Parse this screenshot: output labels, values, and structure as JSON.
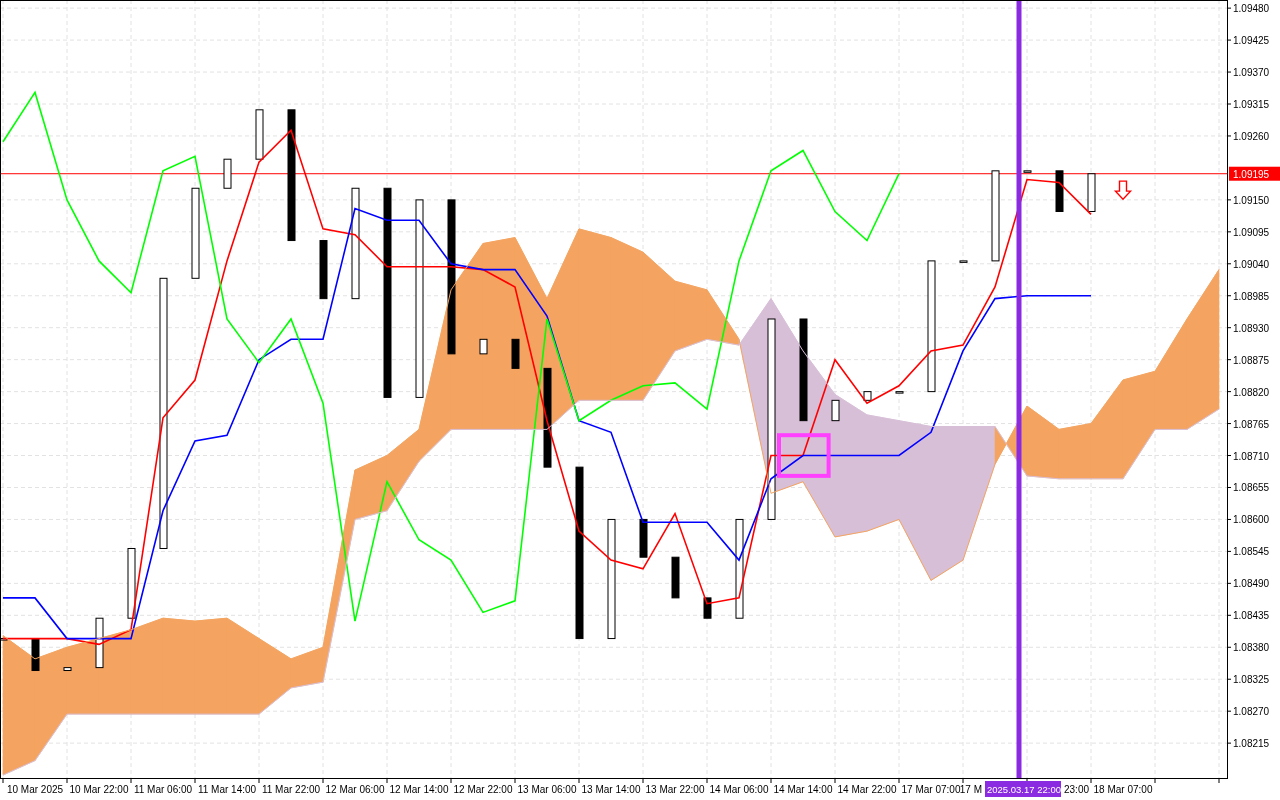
{
  "chart": {
    "chart_data": {
      "type": "line",
      "categories": [
        null,
        "10 Mar 2025",
        null,
        "10 Mar 22:00",
        null,
        "11 Mar 06:00",
        null,
        "11 Mar 14:00",
        null,
        "11 Mar 22:00",
        null,
        "12 Mar 06:00",
        null,
        "12 Mar 14:00",
        null,
        "12 Mar 22:00",
        null,
        "13 Mar 06:00",
        null,
        "13 Mar 14:00",
        null,
        "13 Mar 22:00",
        null,
        "14 Mar 06:00",
        null,
        "14 Mar 14:00",
        null,
        "14 Mar 22:00",
        null,
        "17 Mar 07:00",
        null,
        null,
        null,
        null,
        null,
        "18 Mar 07:00",
        null,
        null,
        null
      ],
      "ylim": [
        1.08155,
        1.09494
      ],
      "grid": true,
      "yticks": [
        {
          "value": 1.0948,
          "label": "1.09480"
        },
        {
          "value": 1.09425,
          "label": "1.09425"
        },
        {
          "value": 1.0937,
          "label": "1.09370"
        },
        {
          "value": 1.09315,
          "label": "1.09315"
        },
        {
          "value": 1.0926,
          "label": "1.09260"
        },
        {
          "value": 1.0915,
          "label": "1.09150"
        },
        {
          "value": 1.09095,
          "label": "1.09095"
        },
        {
          "value": 1.0904,
          "label": "1.09040"
        },
        {
          "value": 1.08985,
          "label": "1.08985"
        },
        {
          "value": 1.0893,
          "label": "1.08930"
        },
        {
          "value": 1.08875,
          "label": "1.08875"
        },
        {
          "value": 1.0882,
          "label": "1.08820"
        },
        {
          "value": 1.08765,
          "label": "1.08765"
        },
        {
          "value": 1.0871,
          "label": "1.08710"
        },
        {
          "value": 1.08655,
          "label": "1.08655"
        },
        {
          "value": 1.086,
          "label": "1.08600"
        },
        {
          "value": 1.08545,
          "label": "1.08545"
        },
        {
          "value": 1.0849,
          "label": "1.08490"
        },
        {
          "value": 1.08435,
          "label": "1.08435"
        },
        {
          "value": 1.0838,
          "label": "1.08380"
        },
        {
          "value": 1.08325,
          "label": "1.08325"
        },
        {
          "value": 1.0827,
          "label": "1.08270"
        },
        {
          "value": 1.08215,
          "label": "1.08215"
        }
      ],
      "series": [
        {
          "color": "#ff0000",
          "values": [
            1.08395,
            1.08395,
            1.08395,
            1.08385,
            1.0841,
            1.08775,
            1.0884,
            1.09045,
            1.09215,
            1.0927,
            1.091,
            1.0909,
            1.09035,
            1.09035,
            1.09035,
            1.0903,
            1.09,
            1.0877,
            1.0858,
            1.0853,
            1.08515,
            1.0861,
            1.08455,
            1.08465,
            1.0871,
            1.0871,
            1.08875,
            1.088,
            1.0883,
            1.0889,
            1.089,
            1.09,
            1.09185,
            1.0918,
            1.09125,
            null,
            null,
            null,
            null
          ]
        },
        {
          "color": "#0000ff",
          "values": [
            1.08465,
            1.08465,
            1.08395,
            1.08395,
            1.08395,
            1.08615,
            1.08735,
            1.08745,
            1.08875,
            1.0891,
            1.0891,
            1.09135,
            1.09115,
            1.09115,
            1.0904,
            1.0903,
            1.0903,
            1.0895,
            1.0877,
            1.0875,
            1.08595,
            1.08595,
            1.08595,
            1.0853,
            1.0867,
            1.0871,
            1.0871,
            1.0871,
            1.0871,
            1.0875,
            1.0889,
            1.0898,
            1.08985,
            1.08985,
            1.08985,
            null,
            null,
            null,
            null
          ]
        },
        {
          "color": "#00ff00",
          "values": [
            1.0925,
            1.09335,
            1.0915,
            1.09045,
            1.0899,
            1.092,
            1.09225,
            1.08945,
            1.0887,
            1.08945,
            1.088,
            1.08425,
            1.08665,
            1.08565,
            1.0853,
            1.0844,
            1.0846,
            1.08945,
            1.0877,
            1.08805,
            1.0883,
            1.08835,
            1.0879,
            1.09045,
            1.092,
            1.09235,
            1.0913,
            1.0908,
            1.09195,
            null,
            null,
            null,
            null,
            null,
            null,
            null,
            null,
            null,
            null
          ]
        },
        {
          "color": "#f4a460",
          "values": [
            1.084,
            1.0836,
            1.0838,
            1.08395,
            1.0841,
            1.0843,
            1.08425,
            1.0843,
            1.08395,
            1.0836,
            1.0838,
            1.08685,
            1.0871,
            1.08755,
            1.08995,
            1.09075,
            1.09085,
            1.0898,
            1.091,
            1.09085,
            1.0906,
            1.0901,
            1.08995,
            1.0891,
            1.08645,
            1.08665,
            1.0857,
            1.0858,
            1.086,
            1.08495,
            1.0853,
            1.08695,
            1.08795,
            1.08755,
            1.08765,
            1.0884,
            1.08855,
            1.08945,
            1.0903
          ]
        },
        {
          "color": "#d8bfd8",
          "values": [
            1.0816,
            1.08185,
            1.08265,
            1.08265,
            1.08265,
            1.08265,
            1.08265,
            1.08265,
            1.08265,
            1.0831,
            1.0832,
            1.086,
            1.08615,
            1.087,
            1.08755,
            1.08755,
            1.08755,
            1.08755,
            1.08805,
            1.08805,
            1.08805,
            1.0889,
            1.0891,
            1.089,
            1.0898,
            1.0889,
            1.08815,
            1.0878,
            1.0877,
            1.0876,
            1.0876,
            1.0876,
            1.08675,
            1.0867,
            1.0867,
            1.0867,
            1.08755,
            1.08755,
            1.0879
          ]
        }
      ],
      "ref_lines": [
        {
          "axis": "y",
          "value": 1.09195,
          "label": "1.09195",
          "color": "#ff0000"
        }
      ]
    },
    "objects": [
      {
        "kind": "vertical_line",
        "label": "2025.03.17 22:00",
        "color": "#8a2be2",
        "covered_axis_labels": [
          "17 M",
          "23:00"
        ]
      },
      {
        "kind": "rectangle",
        "color": "#ff40ff"
      },
      {
        "kind": "arrow",
        "color": "#ff0000"
      }
    ]
  }
}
